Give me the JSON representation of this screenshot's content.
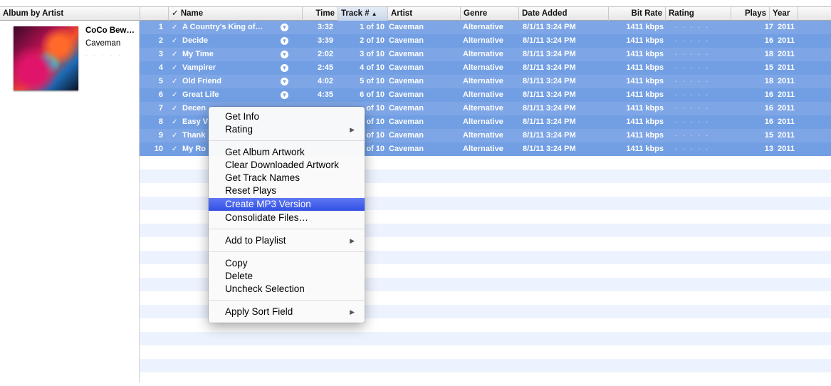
{
  "columns": {
    "album_by_artist": "Album by Artist",
    "check": "✓",
    "name": "Name",
    "time": "Time",
    "track": "Track #",
    "artist": "Artist",
    "genre": "Genre",
    "date_added": "Date Added",
    "bit_rate": "Bit Rate",
    "rating": "Rating",
    "plays": "Plays",
    "year": "Year"
  },
  "album": {
    "title": "CoCo Bew…",
    "artist": "Caveman",
    "rating_dots": "· · · · ·"
  },
  "tracks": [
    {
      "num": "1",
      "check": "✓",
      "name": "A Country's King of…",
      "time": "3:32",
      "track": "1 of 10",
      "artist": "Caveman",
      "genre": "Alternative",
      "date": "8/1/11 3:24 PM",
      "bitrate": "1411 kbps",
      "rating": "· · · · ·",
      "plays": "17",
      "year": "2011"
    },
    {
      "num": "2",
      "check": "✓",
      "name": "Decide",
      "time": "3:39",
      "track": "2 of 10",
      "artist": "Caveman",
      "genre": "Alternative",
      "date": "8/1/11 3:24 PM",
      "bitrate": "1411 kbps",
      "rating": "· · · · ·",
      "plays": "16",
      "year": "2011"
    },
    {
      "num": "3",
      "check": "✓",
      "name": "My Time",
      "time": "2:02",
      "track": "3 of 10",
      "artist": "Caveman",
      "genre": "Alternative",
      "date": "8/1/11 3:24 PM",
      "bitrate": "1411 kbps",
      "rating": "· · · · ·",
      "plays": "18",
      "year": "2011"
    },
    {
      "num": "4",
      "check": "✓",
      "name": "Vampirer",
      "time": "2:45",
      "track": "4 of 10",
      "artist": "Caveman",
      "genre": "Alternative",
      "date": "8/1/11 3:24 PM",
      "bitrate": "1411 kbps",
      "rating": "· · · · ·",
      "plays": "15",
      "year": "2011"
    },
    {
      "num": "5",
      "check": "✓",
      "name": "Old Friend",
      "time": "4:02",
      "track": "5 of 10",
      "artist": "Caveman",
      "genre": "Alternative",
      "date": "8/1/11 3:24 PM",
      "bitrate": "1411 kbps",
      "rating": "· · · · ·",
      "plays": "18",
      "year": "2011"
    },
    {
      "num": "6",
      "check": "✓",
      "name": "Great Life",
      "time": "4:35",
      "track": "6 of 10",
      "artist": "Caveman",
      "genre": "Alternative",
      "date": "8/1/11 3:24 PM",
      "bitrate": "1411 kbps",
      "rating": "· · · · ·",
      "plays": "16",
      "year": "2011"
    },
    {
      "num": "7",
      "check": "✓",
      "name": "Decen",
      "time": "",
      "track": "of 10",
      "artist": "Caveman",
      "genre": "Alternative",
      "date": "8/1/11 3:24 PM",
      "bitrate": "1411 kbps",
      "rating": "· · · · ·",
      "plays": "16",
      "year": "2011"
    },
    {
      "num": "8",
      "check": "✓",
      "name": "Easy V",
      "time": "",
      "track": "of 10",
      "artist": "Caveman",
      "genre": "Alternative",
      "date": "8/1/11 3:24 PM",
      "bitrate": "1411 kbps",
      "rating": "· · · · ·",
      "plays": "16",
      "year": "2011"
    },
    {
      "num": "9",
      "check": "✓",
      "name": "Thank",
      "time": "",
      "track": "of 10",
      "artist": "Caveman",
      "genre": "Alternative",
      "date": "8/1/11 3:24 PM",
      "bitrate": "1411 kbps",
      "rating": "· · · · ·",
      "plays": "15",
      "year": "2011"
    },
    {
      "num": "10",
      "check": "✓",
      "name": "My Ro",
      "time": "",
      "track": "of 10",
      "artist": "Caveman",
      "genre": "Alternative",
      "date": "8/1/11 3:24 PM",
      "bitrate": "1411 kbps",
      "rating": "· · · · ·",
      "plays": "13",
      "year": "2011"
    }
  ],
  "context_menu": {
    "get_info": "Get Info",
    "rating": "Rating",
    "get_album_artwork": "Get Album Artwork",
    "clear_downloaded_artwork": "Clear Downloaded Artwork",
    "get_track_names": "Get Track Names",
    "reset_plays": "Reset Plays",
    "create_mp3_version": "Create MP3 Version",
    "consolidate_files": "Consolidate Files…",
    "add_to_playlist": "Add to Playlist",
    "copy": "Copy",
    "delete": "Delete",
    "uncheck_selection": "Uncheck Selection",
    "apply_sort_field": "Apply Sort Field",
    "submenu_arrow": "▶"
  },
  "colors": {
    "selection": "#7ea6e6",
    "menu_highlight": "#3f5ef0",
    "stripe": "#edf3fe"
  }
}
